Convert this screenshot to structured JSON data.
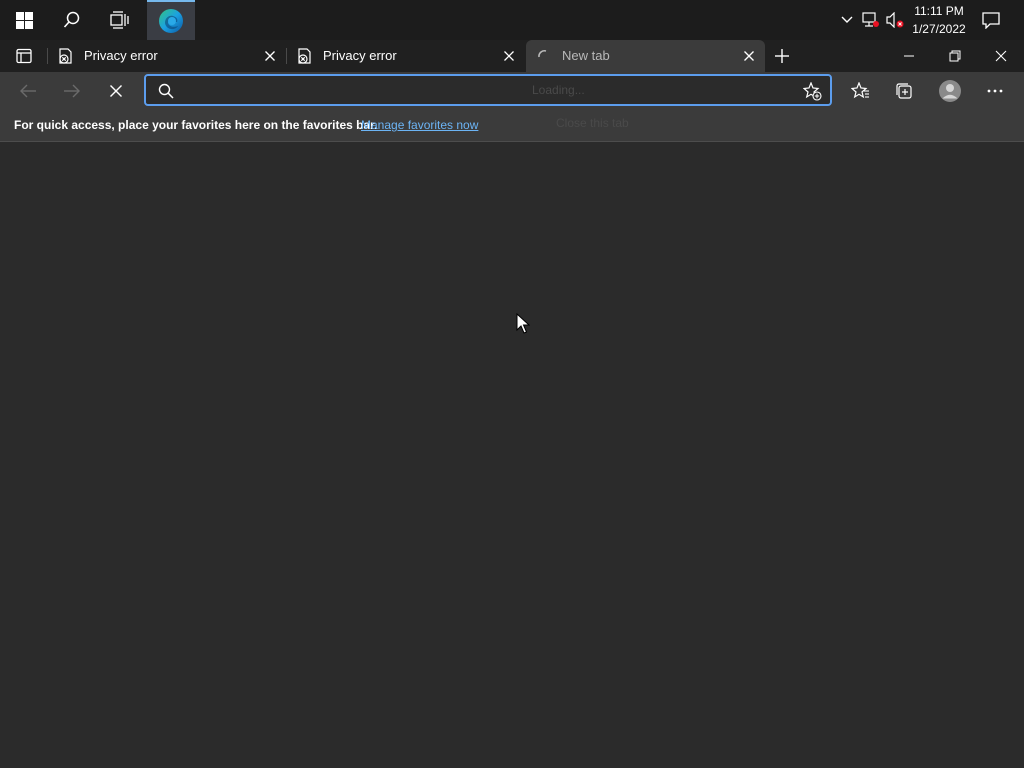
{
  "taskbar": {
    "start_icon": "windows-logo-icon",
    "search_icon": "search-icon",
    "taskview_icon": "task-view-icon",
    "pinned_app_icon": "edge-icon",
    "tray": {
      "chevron_icon": "chevron-up-icon",
      "network_icon": "network-icon",
      "volume_icon": "volume-muted-icon",
      "notifications_icon": "notification-icon"
    },
    "clock": {
      "time": "11:11 PM",
      "date": "1/27/2022"
    }
  },
  "browser": {
    "tabs": [
      {
        "title": "Privacy error",
        "icon": "privacy-error-icon",
        "active": false
      },
      {
        "title": "Privacy error",
        "icon": "privacy-error-icon",
        "active": false
      },
      {
        "title": "New tab",
        "icon": "loading-spinner-icon",
        "active": true
      }
    ],
    "new_tab_icon": "plus-icon",
    "window_controls": {
      "minimize_icon": "minimize-icon",
      "restore_icon": "restore-icon",
      "close_icon": "close-icon"
    },
    "address_bar": {
      "value": "",
      "placeholder": "",
      "ghost_text": "Loading...",
      "ghost_subtext": "Close this tab"
    },
    "favorites_bar": {
      "message": "For quick access, place your favorites here on the favorites bar.",
      "link": "Manage favorites now"
    }
  },
  "colors": {
    "accent": "#5c9ded",
    "link": "#6cb4f5",
    "background": "#2b2b2b",
    "toolbar": "#3b3b3b",
    "taskbar": "#1c1c1c"
  }
}
